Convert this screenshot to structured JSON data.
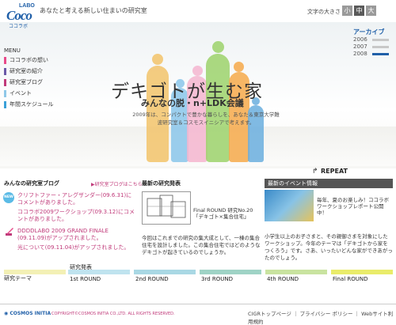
{
  "header": {
    "logo_labo": "LABO",
    "logo_coco": "Coco",
    "logo_kana": "ココラボ",
    "tagline": "あなたと考える新しい住まいの研究室",
    "font_size_label": "文字の大きさ",
    "font_sizes": [
      "小",
      "中",
      "大"
    ]
  },
  "archive": {
    "title": "アーカイブ",
    "items": [
      "2006",
      "2007",
      "2008"
    ]
  },
  "menu": {
    "title": "MENU",
    "items": [
      {
        "label": "ココラボの想い",
        "color": "#e84a8a"
      },
      {
        "label": "研究室の紹介",
        "color": "#6a5aa8"
      },
      {
        "label": "研究室ブログ",
        "color": "#c03a7a"
      },
      {
        "label": "イベント",
        "color": "#8fc8e8"
      },
      {
        "label": "年間スケジュール",
        "color": "#3aa0d8"
      }
    ]
  },
  "hero": {
    "title": "デキゴトが生む家",
    "subtitle": "みんなの脱・n+LDK会議",
    "description": "2009年は、コンパクトで豊かな暮らしを、あなた＆東京大学難波研究室＆コスモスイニシアで考えます。"
  },
  "repeat_label": "REPEAT",
  "blog": {
    "heading": "みんなの研究室ブログ",
    "more": "▶研究室ブログはこちら",
    "new_badge": "NEW",
    "entries": [
      "クリフトファー・アレグザンダー(09.6.31)にコメントがありました。",
      "ココラボ2009ワークショップ(09.3.12)にコメントがありました。",
      "DDDDLABO 2009 GRAND FINALE (09.11.09)がアップされました。",
      "光について(09.11.04)がアップされました。"
    ]
  },
  "news": {
    "heading": "最新の研究発表",
    "caption": "Final ROUND 研究No.20「デキゴト×集合住宅」",
    "text": "今回はこれまでの研究の集大成として、一棟の集合住宅を設計しました。この集合住宅ではどのようなデキゴトが起きているのでしょうか。"
  },
  "event": {
    "heading": "最新のイベント情報",
    "caption": "毎年、夏のお楽しみ！ココラボワークショップレポート公開中！",
    "text": "小学生以上のお子さまと、その親御さまを対象にしたワークショップ。今年のテーマは「デキゴトから家をつくろう」です。さあ、いったいどんな家ができあがったのでしょう。"
  },
  "rounds": {
    "theme_label": "研究テーマ",
    "happyou_label": "研究発表",
    "items": [
      {
        "label": "1st ROUND",
        "color": "#bfe3ef"
      },
      {
        "label": "2nd ROUND",
        "color": "#a9d8e4"
      },
      {
        "label": "3rd ROUND",
        "color": "#9fd3c6"
      },
      {
        "label": "4th ROUND",
        "color": "#c9e3a0"
      },
      {
        "label": "Final ROUND",
        "color": "#e9ec6a"
      }
    ],
    "theme_color": "#f3f0b5"
  },
  "footer": {
    "cosmos": "COSMOS INITIA",
    "copyright": "COPYRIGHT©COSMOS INITIA CO.,LTD. ALL RIGHTS RESERVED.",
    "links": "CIGRトップページ ｜ プライバシー ポリシー ｜ Webサイト利用規約"
  }
}
